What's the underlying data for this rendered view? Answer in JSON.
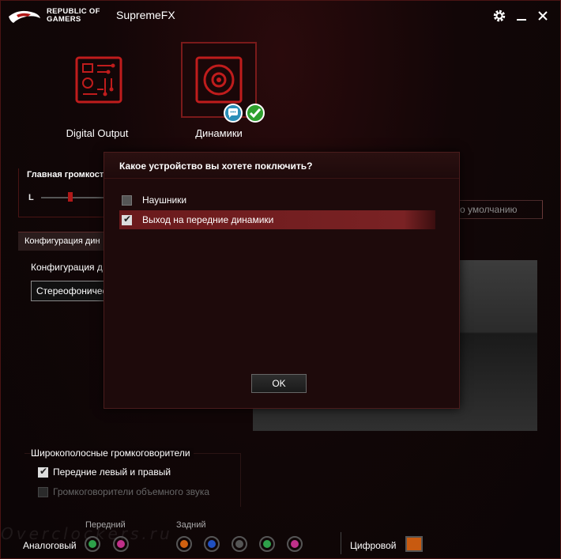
{
  "titlebar": {
    "brand_line1": "REPUBLIC OF",
    "brand_line2": "GAMERS",
    "app_title": "SupremeFX",
    "settings_icon": "gear-icon",
    "minimize_icon": "minimize-icon",
    "close_icon": "close-icon"
  },
  "devices": [
    {
      "label": "Digital Output",
      "icon": "circuit-board-icon",
      "selected": false
    },
    {
      "label": "Динамики",
      "icon": "speaker-icon",
      "selected": true,
      "badges": [
        "chat-bubble-icon",
        "checkmark-icon"
      ]
    }
  ],
  "volume": {
    "title": "Главная громкость",
    "left_label": "L"
  },
  "default_button": "о умолчанию",
  "config": {
    "tab_label": "Конфигурация дин",
    "section_label": "Конфигурация д",
    "select_value": "Стереофоничес"
  },
  "wideband": {
    "title": "Широкополосные громкоговорители",
    "options": [
      {
        "label": "Передние левый и правый",
        "checked": true,
        "enabled": true
      },
      {
        "label": "Громкоговорители объемного звука",
        "checked": false,
        "enabled": false
      }
    ]
  },
  "bottom": {
    "front_label": "Передний",
    "rear_label": "Задний",
    "analog_label": "Аналоговый",
    "digital_label": "Цифровой",
    "jacks": [
      {
        "color": "#2ea04a"
      },
      {
        "color": "#c0308a"
      },
      {
        "color": "#d06010"
      },
      {
        "color": "#2050c0"
      },
      {
        "color": "#555555"
      },
      {
        "color": "#2ea04a"
      },
      {
        "color": "#c0308a"
      }
    ]
  },
  "dialog": {
    "title": "Какое устройство вы хотете поключить?",
    "options": [
      {
        "label": "Наушники",
        "checked": false,
        "selected": false
      },
      {
        "label": "Выход на передние динамики",
        "checked": true,
        "selected": true
      }
    ],
    "ok_label": "OK"
  },
  "colors": {
    "accent": "#b01818",
    "selection": "#7a2224"
  }
}
